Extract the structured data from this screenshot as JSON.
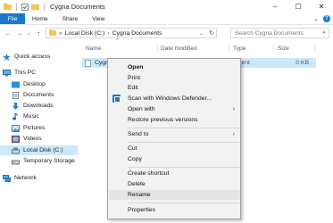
{
  "window": {
    "title": "Cygna Documents",
    "minimize": "–",
    "maximize": "☐",
    "close": "✕"
  },
  "ribbon": {
    "tabs": [
      "File",
      "Home",
      "Share",
      "View"
    ],
    "expand_icon": "chevron-down-icon",
    "help_label": "?"
  },
  "address": {
    "back": "←",
    "forward": "→",
    "recent": "⌄",
    "up": "↑",
    "overflow": "«",
    "path": [
      "Local Disk (C:)",
      "Cygna Documents"
    ],
    "separator": "›",
    "dropdown": "⌄",
    "refresh": "↻"
  },
  "search": {
    "placeholder": "Search Cygna Documents",
    "icon": "⌕"
  },
  "nav": {
    "items": [
      {
        "label": "Quick access",
        "icon": "star-icon"
      },
      {
        "label": "This PC",
        "icon": "pc-icon"
      },
      {
        "label": "Desktop",
        "icon": "desktop-icon"
      },
      {
        "label": "Documents",
        "icon": "documents-icon"
      },
      {
        "label": "Downloads",
        "icon": "downloads-icon"
      },
      {
        "label": "Music",
        "icon": "music-icon"
      },
      {
        "label": "Pictures",
        "icon": "pictures-icon"
      },
      {
        "label": "Videos",
        "icon": "videos-icon"
      },
      {
        "label": "Local Disk (C:)",
        "icon": "drive-icon",
        "selected": true
      },
      {
        "label": "Temporary Storage",
        "icon": "drive-icon"
      },
      {
        "label": "Network",
        "icon": "network-icon"
      }
    ]
  },
  "columns": {
    "name": "Name",
    "date": "Date modified",
    "type": "Type",
    "size": "Size",
    "sort_caret": "^"
  },
  "files": [
    {
      "name": "Cygn",
      "type": "ument",
      "size": "0 KB"
    }
  ],
  "context_menu": {
    "items": [
      {
        "label": "Open",
        "bold": true
      },
      {
        "label": "Print"
      },
      {
        "label": "Edit"
      },
      {
        "label": "Scan with Windows Defender...",
        "icon": "defender-icon"
      },
      {
        "label": "Open with",
        "submenu": true
      },
      {
        "label": "Restore previous versions"
      },
      {
        "label": "Send to",
        "submenu": true
      },
      {
        "label": "Cut"
      },
      {
        "label": "Copy"
      },
      {
        "label": "Create shortcut"
      },
      {
        "label": "Delete"
      },
      {
        "label": "Rename",
        "hover": true
      },
      {
        "label": "Properties"
      }
    ],
    "submenu_arrow": "›"
  },
  "colors": {
    "accent": "#1979ca",
    "selection": "#cce8ff",
    "menu_bg": "#f2f2f2",
    "folder": "#f3c74f"
  }
}
